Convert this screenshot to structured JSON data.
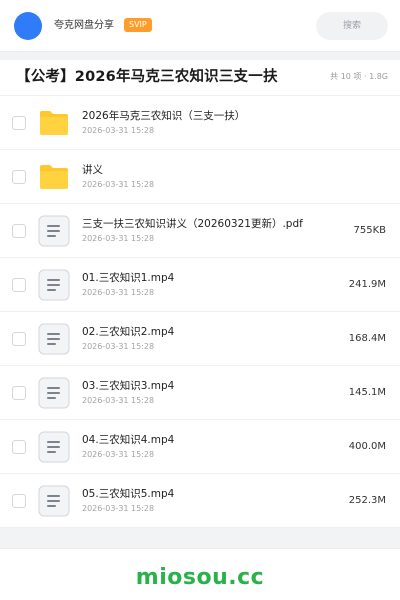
{
  "header": {
    "app_name": "夸克网盘分享",
    "badge": "SVIP",
    "search_label": "搜索",
    "accent_color": "#2f7cf6"
  },
  "folder": {
    "title": "【公考】2026年马克三农知识三支一扶",
    "meta": "共 10 项 · 1.8G"
  },
  "files": [
    {
      "icon": "folder-icon",
      "name": "2026年马克三农知识（三支一扶）",
      "date": "2026-03-31 15:28",
      "size": ""
    },
    {
      "icon": "folder-icon",
      "name": "讲义",
      "date": "2026-03-31 15:28",
      "size": ""
    },
    {
      "icon": "document-icon",
      "name": "三支一扶三农知识讲义（20260321更新）.pdf",
      "date": "2026-03-31 15:28",
      "size": "755KB"
    },
    {
      "icon": "document-icon",
      "name": "01.三农知识1.mp4",
      "date": "2026-03-31 15:28",
      "size": "241.9M"
    },
    {
      "icon": "document-icon",
      "name": "02.三农知识2.mp4",
      "date": "2026-03-31 15:28",
      "size": "168.4M"
    },
    {
      "icon": "document-icon",
      "name": "03.三农知识3.mp4",
      "date": "2026-03-31 15:28",
      "size": "145.1M"
    },
    {
      "icon": "document-icon",
      "name": "04.三农知识4.mp4",
      "date": "2026-03-31 15:28",
      "size": "400.0M"
    },
    {
      "icon": "document-icon",
      "name": "05.三农知识5.mp4",
      "date": "2026-03-31 15:28",
      "size": "252.3M"
    }
  ],
  "watermark": "miosou.cc"
}
